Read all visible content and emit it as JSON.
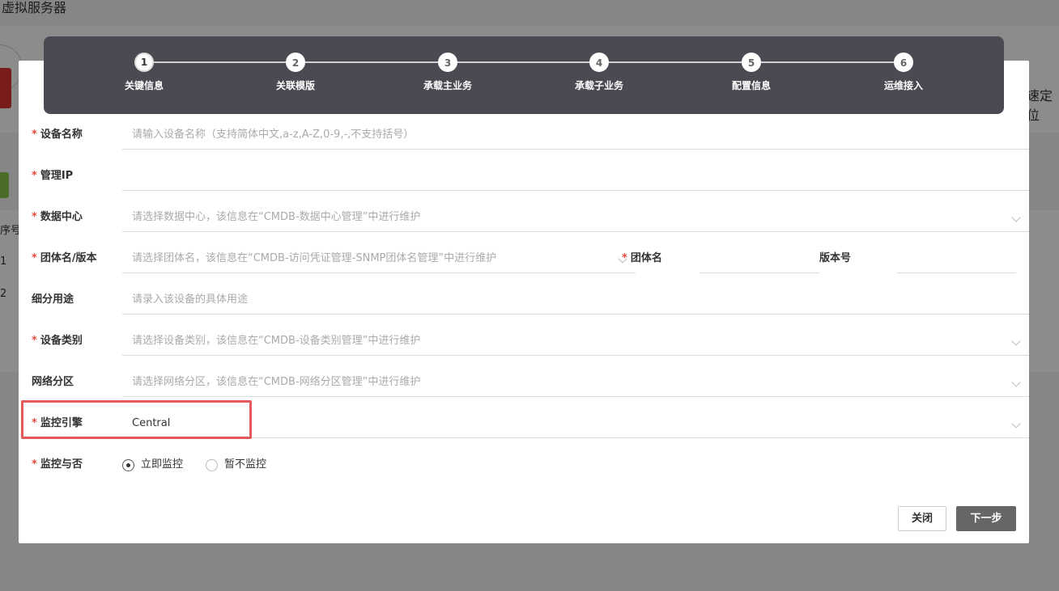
{
  "background": {
    "page_title": "虚拟服务器",
    "right_text": "速定位",
    "table": {
      "header": "序号",
      "rows": [
        "1",
        "2"
      ]
    }
  },
  "stepper": {
    "steps": [
      {
        "number": "1",
        "label": "关键信息",
        "active": true
      },
      {
        "number": "2",
        "label": "关联模版"
      },
      {
        "number": "3",
        "label": "承载主业务"
      },
      {
        "number": "4",
        "label": "承载子业务"
      },
      {
        "number": "5",
        "label": "配置信息"
      },
      {
        "number": "6",
        "label": "运维接入"
      }
    ]
  },
  "form": {
    "device_name": {
      "label": "设备名称",
      "required": true,
      "placeholder": "请输入设备名称（支持简体中文,a-z,A-Z,0-9,-,不支持括号）"
    },
    "mgmt_ip": {
      "label": "管理IP",
      "required": true,
      "value": ""
    },
    "datacenter": {
      "label": "数据中心",
      "required": true,
      "placeholder": "请选择数据中心，该信息在“CMDB-数据中心管理”中进行维护"
    },
    "community": {
      "label": "团体名/版本",
      "required": true,
      "placeholder": "请选择团体名，该信息在“CMDB-访问凭证管理-SNMP团体名管理”中进行维护"
    },
    "community_name": {
      "label": "团体名",
      "required": true
    },
    "version": {
      "label": "版本号"
    },
    "usage": {
      "label": "细分用途",
      "placeholder": "请录入该设备的具体用途"
    },
    "device_type": {
      "label": "设备类别",
      "required": true,
      "placeholder": "请选择设备类别，该信息在“CMDB-设备类别管理”中进行维护"
    },
    "network_zone": {
      "label": "网络分区",
      "placeholder": "请选择网络分区，该信息在“CMDB-网络分区管理”中进行维护"
    },
    "monitor_engine": {
      "label": "监控引擎",
      "required": true,
      "value": "Central"
    },
    "monitor": {
      "label": "监控与否",
      "required": true,
      "options": [
        "立即监控",
        "暂不监控"
      ],
      "selected": "立即监控"
    }
  },
  "buttons": {
    "close": "关闭",
    "next": "下一步"
  },
  "colors": {
    "stepper_bg": "#4a4a52",
    "required": "#e74c3c",
    "highlight": "#e55a5a",
    "primary_btn": "#666666"
  }
}
